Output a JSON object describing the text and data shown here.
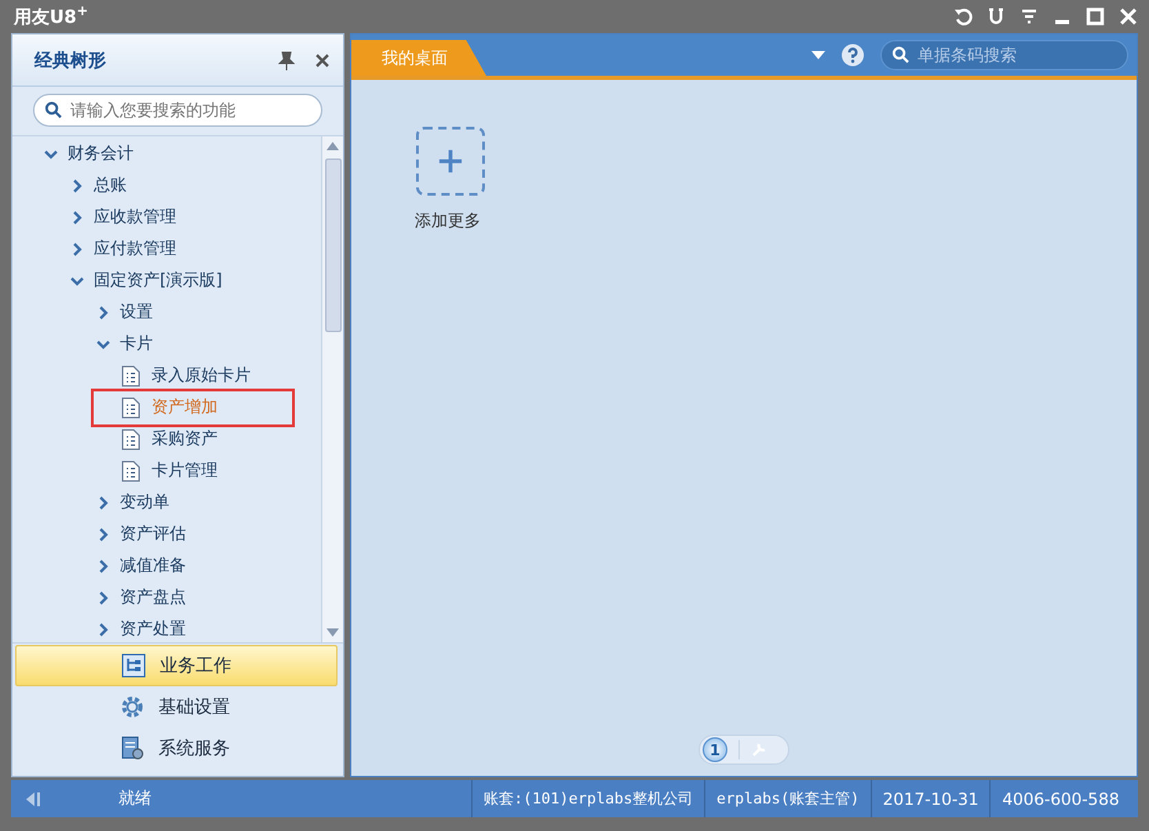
{
  "window": {
    "title": "用友U8",
    "title_sup": "+"
  },
  "sidebar": {
    "title": "经典树形",
    "search": {
      "placeholder": "请输入您要搜索的功能"
    },
    "tree": [
      {
        "label": "财务会计",
        "kind": "folder",
        "expanded": true,
        "selected": false,
        "children": [
          {
            "label": "总账",
            "kind": "folder",
            "expanded": false,
            "selected": false
          },
          {
            "label": "应收款管理",
            "kind": "folder",
            "expanded": false,
            "selected": false
          },
          {
            "label": "应付款管理",
            "kind": "folder",
            "expanded": false,
            "selected": false
          },
          {
            "label": "固定资产[演示版]",
            "kind": "folder",
            "expanded": true,
            "selected": false,
            "children": [
              {
                "label": "设置",
                "kind": "folder",
                "expanded": false,
                "selected": false
              },
              {
                "label": "卡片",
                "kind": "folder",
                "expanded": true,
                "selected": false,
                "children": [
                  {
                    "label": "录入原始卡片",
                    "kind": "doc",
                    "selected": false
                  },
                  {
                    "label": "资产增加",
                    "kind": "doc",
                    "selected": true,
                    "highlighted": true
                  },
                  {
                    "label": "采购资产",
                    "kind": "doc",
                    "selected": false
                  },
                  {
                    "label": "卡片管理",
                    "kind": "doc",
                    "selected": false
                  }
                ]
              },
              {
                "label": "变动单",
                "kind": "folder",
                "expanded": false,
                "selected": false
              },
              {
                "label": "资产评估",
                "kind": "folder",
                "expanded": false,
                "selected": false
              },
              {
                "label": "减值准备",
                "kind": "folder",
                "expanded": false,
                "selected": false
              },
              {
                "label": "资产盘点",
                "kind": "folder",
                "expanded": false,
                "selected": false
              },
              {
                "label": "资产处置",
                "kind": "folder",
                "expanded": false,
                "selected": false
              }
            ]
          }
        ]
      }
    ],
    "nav": [
      {
        "label": "业务工作",
        "selected": true
      },
      {
        "label": "基础设置",
        "selected": false
      },
      {
        "label": "系统服务",
        "selected": false
      }
    ]
  },
  "tabs": [
    {
      "label": "我的桌面",
      "selected": true
    }
  ],
  "search": {
    "placeholder": "单据条码搜索"
  },
  "desktop": {
    "add_label": "添加更多",
    "page": "1"
  },
  "status_bar": {
    "status": "就绪",
    "account": "账套:(101)erplabs整机公司",
    "user": "erplabs(账套主管)",
    "date": "2017-10-31",
    "phone": "4006-600-588"
  }
}
